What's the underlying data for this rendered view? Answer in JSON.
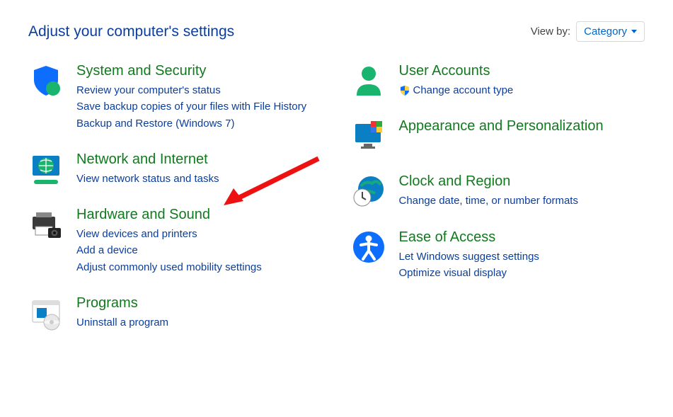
{
  "header": {
    "title": "Adjust your computer's settings",
    "viewby_label": "View by:",
    "viewby_value": "Category"
  },
  "left_column": [
    {
      "id": "system-security",
      "title": "System and Security",
      "links": [
        "Review your computer's status",
        "Save backup copies of your files with File History",
        "Backup and Restore (Windows 7)"
      ]
    },
    {
      "id": "network-internet",
      "title": "Network and Internet",
      "links": [
        "View network status and tasks"
      ]
    },
    {
      "id": "hardware-sound",
      "title": "Hardware and Sound",
      "links": [
        "View devices and printers",
        "Add a device",
        "Adjust commonly used mobility settings"
      ]
    },
    {
      "id": "programs",
      "title": "Programs",
      "links": [
        "Uninstall a program"
      ]
    }
  ],
  "right_column": [
    {
      "id": "user-accounts",
      "title": "User Accounts",
      "links": [
        "Change account type"
      ],
      "shield_on_first": true
    },
    {
      "id": "appearance-personalization",
      "title": "Appearance and Personalization",
      "links": []
    },
    {
      "id": "clock-region",
      "title": "Clock and Region",
      "links": [
        "Change date, time, or number formats"
      ]
    },
    {
      "id": "ease-of-access",
      "title": "Ease of Access",
      "links": [
        "Let Windows suggest settings",
        "Optimize visual display"
      ]
    }
  ]
}
